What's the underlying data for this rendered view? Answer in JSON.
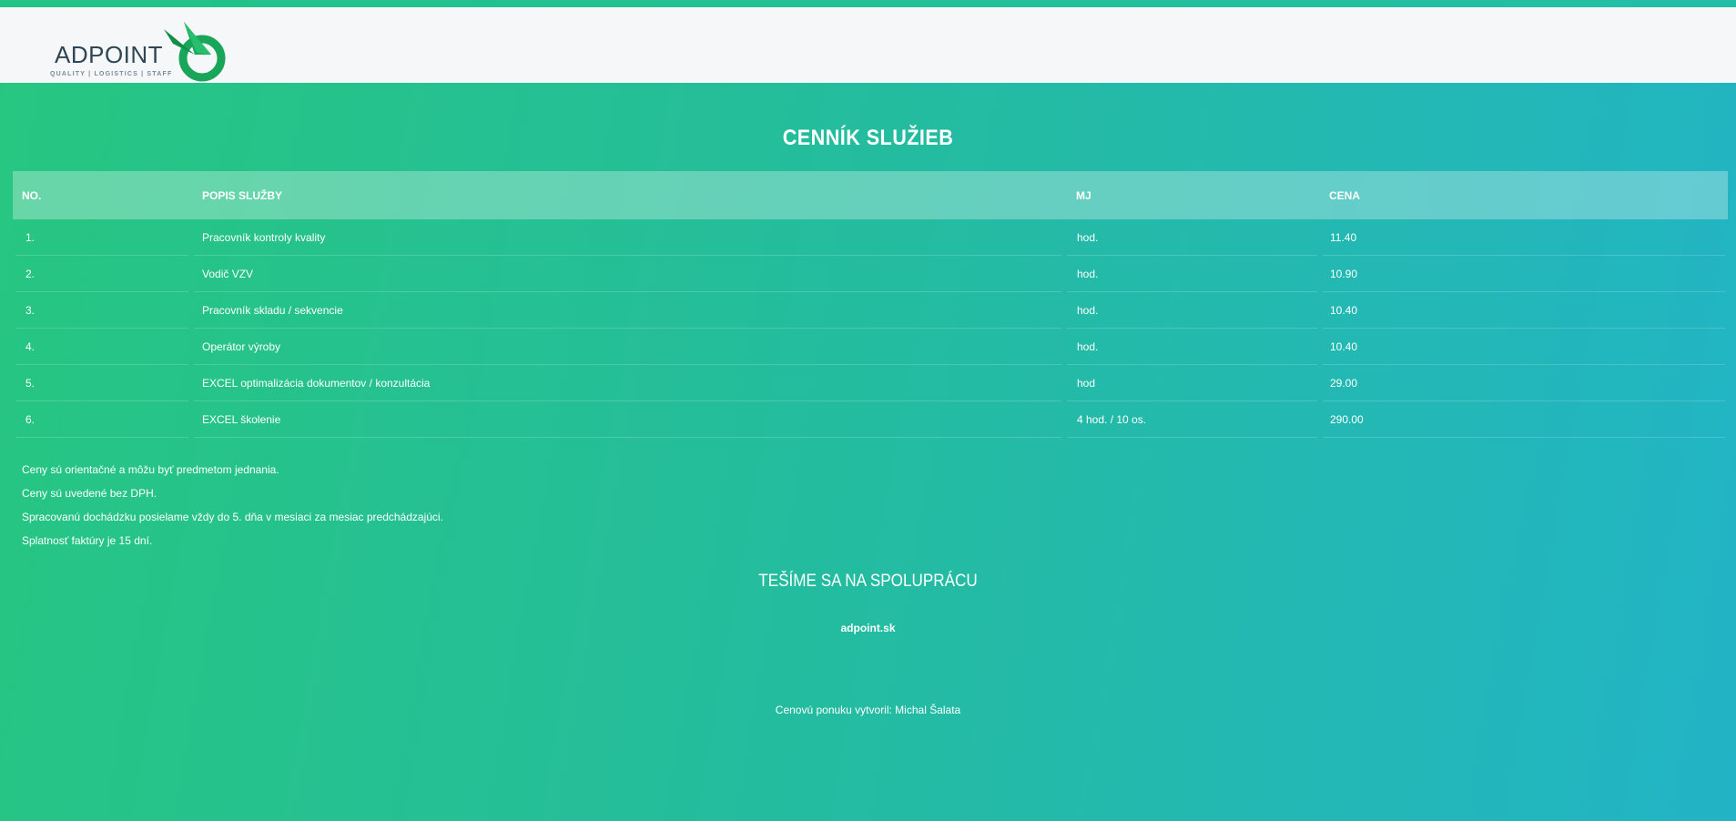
{
  "brand": {
    "name": "ADPOINT",
    "tagline": "QUALITY | LOGISTICS | STAFF",
    "primary_color": "#1aa65a",
    "text_color": "#2e4656"
  },
  "page": {
    "title": "CENNÍK SLUŽIEB"
  },
  "table": {
    "headers": {
      "no": "NO.",
      "desc": "POPIS SLUŽBY",
      "unit": "MJ",
      "price": "CENA"
    },
    "rows": [
      {
        "no": "1.",
        "desc": "Pracovník kontroly kvality",
        "unit": "hod.",
        "price": "11.40"
      },
      {
        "no": "2.",
        "desc": "Vodič VZV",
        "unit": "hod.",
        "price": "10.90"
      },
      {
        "no": "3.",
        "desc": "Pracovník skladu / sekvencie",
        "unit": "hod.",
        "price": "10.40"
      },
      {
        "no": "4.",
        "desc": "Operátor výroby",
        "unit": "hod.",
        "price": "10.40"
      },
      {
        "no": "5.",
        "desc": "EXCEL optimalizácia dokumentov / konzultácia",
        "unit": "hod",
        "price": "29.00"
      },
      {
        "no": "6.",
        "desc": "EXCEL školenie",
        "unit": "4 hod. / 10 os.",
        "price": "290.00"
      }
    ]
  },
  "notes": [
    "Ceny sú orientačné a môžu byť predmetom jednania.",
    "Ceny sú uvedené bez DPH.",
    "Spracovanú dochádzku posielame vždy do 5. dňa v mesiaci za mesiac predchádzajúci.",
    "Splatnosť faktúry je 15 dní."
  ],
  "footer": {
    "cta": "TEŠÍME SA NA SPOLUPRÁCU",
    "website": "adpoint.sk",
    "author": "Cenovú ponuku vytvoril:  Michal Šalata"
  }
}
